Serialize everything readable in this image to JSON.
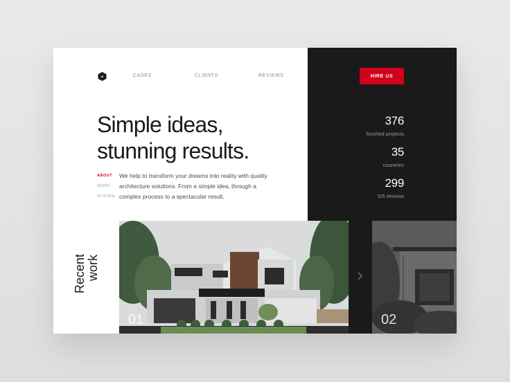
{
  "nav": {
    "items": [
      {
        "label": "CASES"
      },
      {
        "label": "CLIENTS"
      },
      {
        "label": "REVIEWS"
      }
    ],
    "hire_label": "HIRE US"
  },
  "hero": {
    "headline_line1": "Simple ideas,",
    "headline_line2": "stunning results.",
    "tabs": [
      {
        "label": "ABOUT",
        "active": true
      },
      {
        "label": "WORK",
        "active": false
      },
      {
        "label": "SYSTEM",
        "active": false
      }
    ],
    "description": "We help to transform your dreams into reality with quality architecture solutions. From a simple idea, through a complex process to a spectacular result."
  },
  "stats": [
    {
      "value": "376",
      "label": "finished projects"
    },
    {
      "value": "35",
      "label": "countries"
    },
    {
      "value": "299",
      "label": "5/5 reviews"
    }
  ],
  "recent": {
    "line1": "Recent",
    "line2": "work",
    "projects": [
      {
        "number": "01"
      },
      {
        "number": "02"
      }
    ]
  },
  "colors": {
    "accent": "#d0021b",
    "dark": "#1a1a1a",
    "text": "#1a1a1a"
  },
  "icons": {
    "logo": "logo-hexagon-icon",
    "next": "chevron-right-icon"
  }
}
